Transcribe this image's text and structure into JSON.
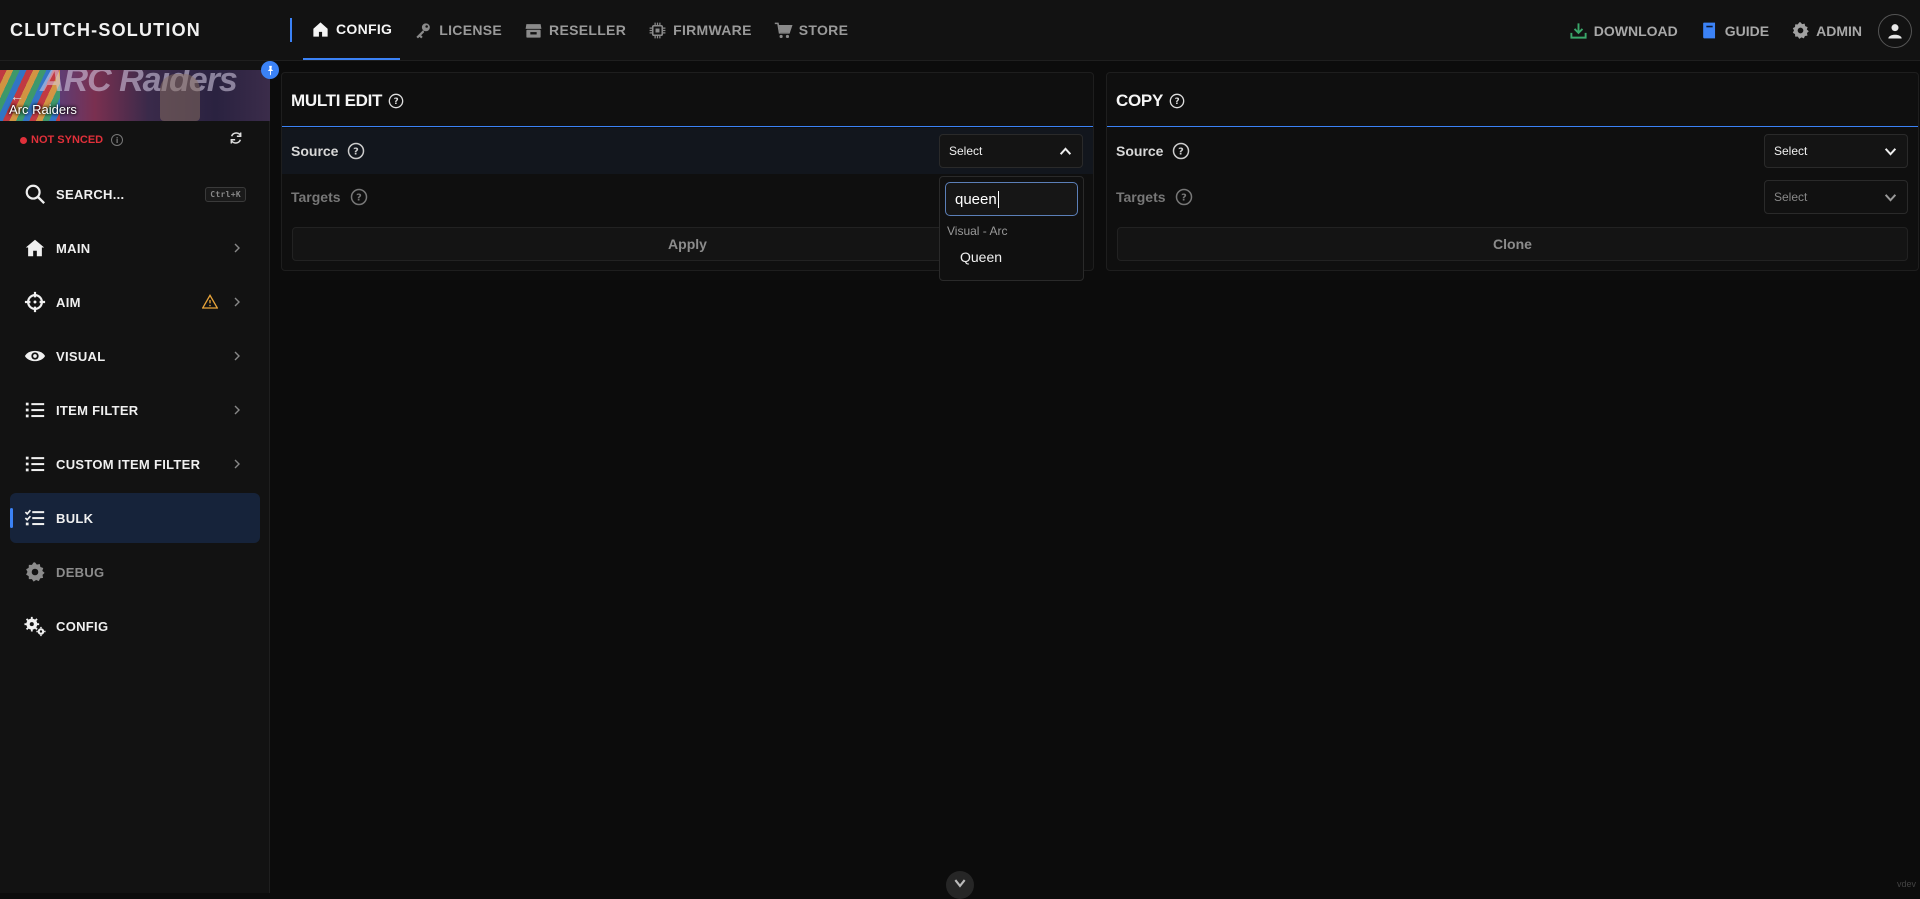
{
  "app": {
    "brand": "CLUTCH-SOLUTION"
  },
  "top_nav": [
    {
      "label": "CONFIG",
      "icon": "home-icon",
      "active": true
    },
    {
      "label": "LICENSE",
      "icon": "key-icon",
      "active": false
    },
    {
      "label": "RESELLER",
      "icon": "store-icon",
      "active": false
    },
    {
      "label": "FIRMWARE",
      "icon": "chip-icon",
      "active": false
    },
    {
      "label": "STORE",
      "icon": "cart-icon",
      "active": false
    }
  ],
  "right_nav": {
    "download": "DOWNLOAD",
    "guide": "GUIDE",
    "admin": "ADMIN"
  },
  "sidebar": {
    "game_title": "Arc Raiders",
    "banner_art_text": "ARC Raiders",
    "sync_status": "NOT SYNCED",
    "search": {
      "label": "SEARCH...",
      "shortcut": "Ctrl+K"
    },
    "items": [
      {
        "label": "MAIN",
        "icon": "home-icon"
      },
      {
        "label": "AIM",
        "icon": "crosshair-icon",
        "warning": true
      },
      {
        "label": "VISUAL",
        "icon": "eye-icon"
      },
      {
        "label": "ITEM FILTER",
        "icon": "list-icon"
      },
      {
        "label": "CUSTOM ITEM FILTER",
        "icon": "list-icon"
      },
      {
        "label": "BULK",
        "icon": "checklist-icon",
        "active": true
      },
      {
        "label": "DEBUG",
        "icon": "gear-icon",
        "muted": true
      },
      {
        "label": "CONFIG",
        "icon": "gears-icon"
      }
    ]
  },
  "multi_edit": {
    "title": "MULTI EDIT",
    "source_label": "Source",
    "source_value": "Select",
    "targets_label": "Targets",
    "apply_label": "Apply",
    "dropdown": {
      "search_value": "queen",
      "group": "Visual - Arc",
      "option": "Queen"
    }
  },
  "copy": {
    "title": "COPY",
    "source_label": "Source",
    "source_value": "Select",
    "targets_label": "Targets",
    "targets_value": "Select",
    "clone_label": "Clone"
  },
  "footer": {
    "corner_text": "vdev"
  },
  "colors": {
    "accent": "#3b82f6",
    "danger": "#e0303a",
    "warning": "#e8a43a",
    "download": "#3aa86a"
  }
}
